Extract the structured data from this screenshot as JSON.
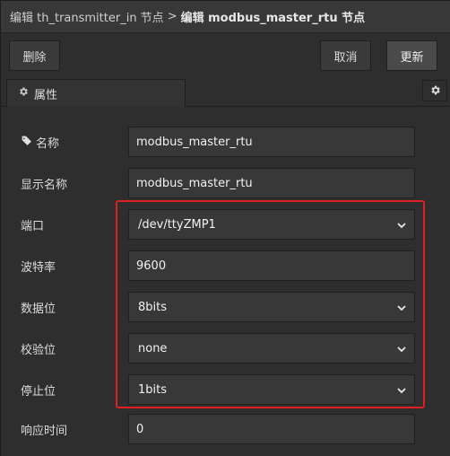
{
  "breadcrumb": {
    "parent": "编辑 th_transmitter_in 节点",
    "separator": ">",
    "current": "编辑 modbus_master_rtu 节点"
  },
  "toolbar": {
    "delete_label": "删除",
    "cancel_label": "取消",
    "update_label": "更新"
  },
  "tabs": {
    "properties_label": "属性"
  },
  "form": {
    "name": {
      "label": "名称",
      "value": "modbus_master_rtu"
    },
    "display_name": {
      "label": "显示名称",
      "value": "modbus_master_rtu"
    },
    "port": {
      "label": "端口",
      "value": "/dev/ttyZMP1"
    },
    "baud_rate": {
      "label": "波特率",
      "value": "9600"
    },
    "data_bits": {
      "label": "数据位",
      "value": "8bits"
    },
    "parity": {
      "label": "校验位",
      "value": "none"
    },
    "stop_bits": {
      "label": "停止位",
      "value": "1bits"
    },
    "response_time": {
      "label": "响应时间",
      "value": "0"
    }
  },
  "icons": {
    "tab_icon": "gear-icon",
    "name_icon": "tag-icon",
    "settings_icon": "gear-icon",
    "select_caret": "chevron-down-icon"
  },
  "colors": {
    "highlight_border": "#e02020",
    "panel_bg": "#2e2e2e",
    "field_bg": "#383838"
  }
}
